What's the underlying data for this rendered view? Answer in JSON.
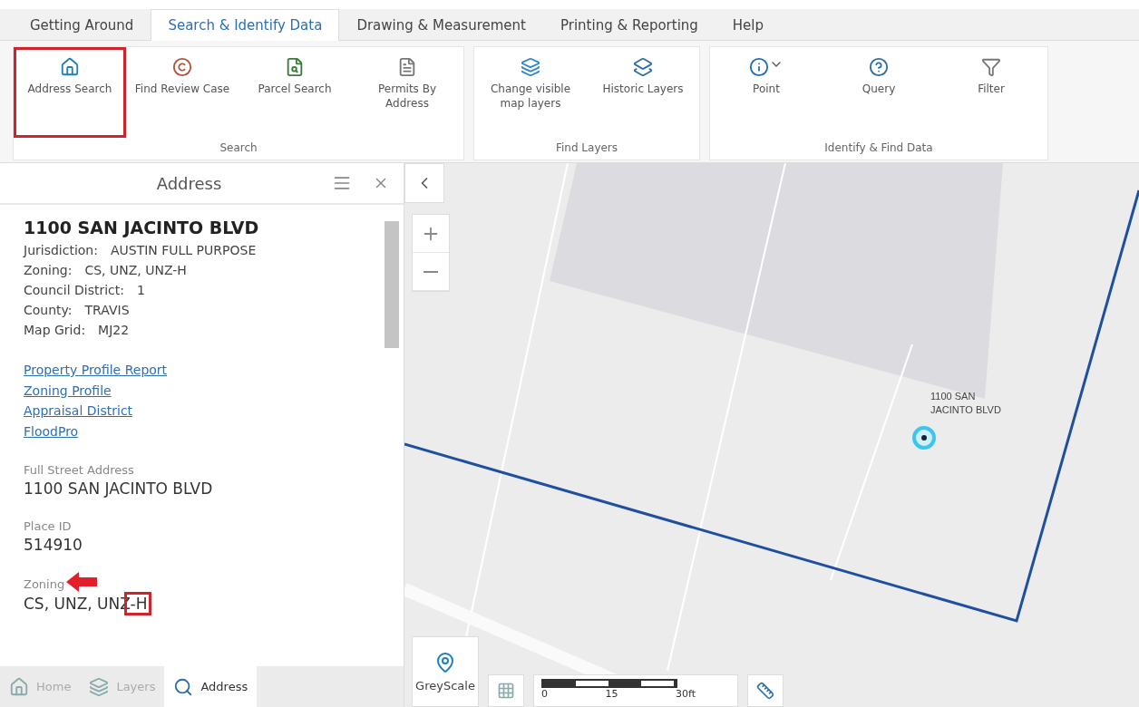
{
  "tabs": [
    {
      "label": "Getting Around",
      "selected": false
    },
    {
      "label": "Search & Identify Data",
      "selected": true
    },
    {
      "label": "Drawing & Measurement",
      "selected": false
    },
    {
      "label": "Printing & Reporting",
      "selected": false
    },
    {
      "label": "Help",
      "selected": false
    }
  ],
  "ribbon": [
    {
      "label": "Search",
      "buttons": [
        {
          "label": "Address Search",
          "highlighted": true
        },
        {
          "label": "Find Review Case",
          "highlighted": false
        },
        {
          "label": "Parcel Search",
          "highlighted": false
        },
        {
          "label": "Permits By Address",
          "highlighted": false
        }
      ]
    },
    {
      "label": "Find Layers",
      "buttons": [
        {
          "label": "Change visible map layers",
          "highlighted": false
        },
        {
          "label": "Historic Layers",
          "highlighted": false
        }
      ]
    },
    {
      "label": "Identify & Find Data",
      "buttons": [
        {
          "label": "Point",
          "highlighted": false
        },
        {
          "label": "Query",
          "highlighted": false
        },
        {
          "label": "Filter",
          "highlighted": false
        }
      ]
    }
  ],
  "panel": {
    "title": "Address",
    "heading": "1100 SAN JACINTO BLVD",
    "facts": [
      {
        "label": "Jurisdiction:",
        "value": "AUSTIN FULL PURPOSE"
      },
      {
        "label": "Zoning:",
        "value": "CS, UNZ, UNZ-H"
      },
      {
        "label": "Council District:",
        "value": "1"
      },
      {
        "label": "County:",
        "value": "TRAVIS"
      },
      {
        "label": "Map Grid:",
        "value": "MJ22"
      }
    ],
    "links": [
      "Property Profile Report",
      "Zoning Profile",
      "Appraisal District",
      "FloodPro"
    ],
    "fields": [
      {
        "label": "Full Street Address",
        "value": "1100 SAN JACINTO BLVD",
        "annotated": false
      },
      {
        "label": "Place ID",
        "value": "514910",
        "annotated": false
      },
      {
        "label": "Zoning",
        "value": "CS, UNZ, UNZ-H",
        "annotated": true
      }
    ]
  },
  "bottom_tabs": [
    {
      "label": "Home",
      "selected": false
    },
    {
      "label": "Layers",
      "selected": false
    },
    {
      "label": "Address",
      "selected": true
    }
  ],
  "map": {
    "label": "1100 SAN JACINTO BLVD",
    "basemap": "GreyScale",
    "scale": [
      "0",
      "15",
      "30ft"
    ]
  }
}
